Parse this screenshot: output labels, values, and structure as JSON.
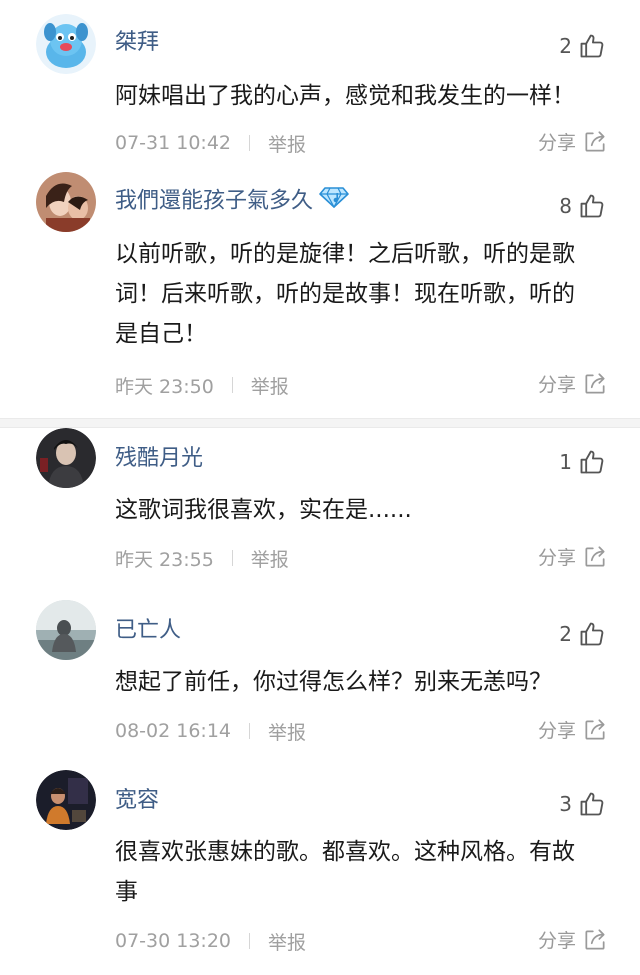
{
  "comments": [
    {
      "username": "桀拜",
      "likes": "2",
      "text": "阿妹唱出了我的心声，感觉和我发生的一样！",
      "time": "07-31 10:42",
      "report": "举报",
      "share": "分享",
      "avatar_icon": "blue-cartoon-dog-avatar"
    },
    {
      "username": "我們還能孩子氣多久",
      "likes": "8",
      "text": "以前听歌，听的是旋律！之后听歌，听的是歌词！后来听歌，听的是故事！现在听歌，听的是自己！",
      "time": "昨天 23:50",
      "report": "举报",
      "share": "分享",
      "badge_icon": "diamond-badge-icon",
      "avatar_icon": "photo-avatar-person"
    },
    {
      "username": "残酷月光",
      "likes": "1",
      "text": "这歌词我很喜欢，实在是......",
      "time": "昨天 23:55",
      "report": "举报",
      "share": "分享",
      "avatar_icon": "photo-avatar-dark-figure"
    },
    {
      "username": "已亡人",
      "likes": "2",
      "text": "想起了前任，你过得怎么样？别来无恙吗？",
      "time": "08-02 16:14",
      "report": "举报",
      "share": "分享",
      "avatar_icon": "photo-avatar-seaside"
    },
    {
      "username": "宽容",
      "likes": "3",
      "text": "很喜欢张惠妹的歌。都喜欢。这种风格。有故事",
      "time": "07-30 13:20",
      "report": "举报",
      "share": "分享",
      "avatar_icon": "photo-avatar-night-scene"
    }
  ],
  "colors": {
    "username": "#3f5d86",
    "meta": "#a0a0a0",
    "divider": "#f4f4f4"
  }
}
